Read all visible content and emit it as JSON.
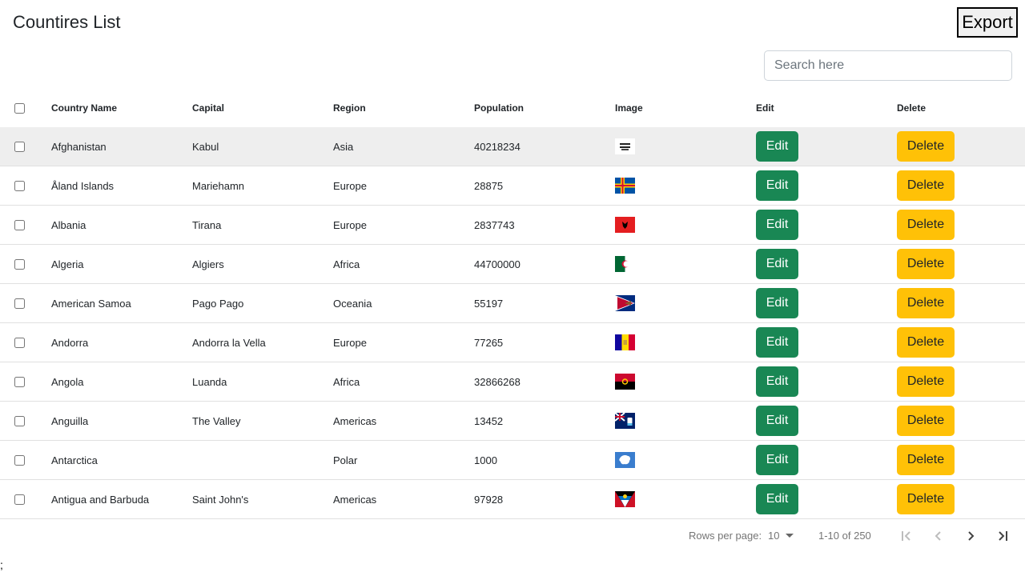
{
  "page": {
    "title": "Countires List",
    "export_label": "Export",
    "trailing_text": ";"
  },
  "search": {
    "placeholder": "Search here",
    "value": ""
  },
  "table": {
    "headers": {
      "name": "Country Name",
      "capital": "Capital",
      "region": "Region",
      "population": "Population",
      "image": "Image",
      "edit": "Edit",
      "delete": "Delete"
    },
    "rows": [
      {
        "name": "Afghanistan",
        "capital": "Kabul",
        "region": "Asia",
        "population": "40218234",
        "flag": "afghanistan-flag",
        "edit": "Edit",
        "delete": "Delete"
      },
      {
        "name": "Åland Islands",
        "capital": "Mariehamn",
        "region": "Europe",
        "population": "28875",
        "flag": "aland-flag",
        "edit": "Edit",
        "delete": "Delete"
      },
      {
        "name": "Albania",
        "capital": "Tirana",
        "region": "Europe",
        "population": "2837743",
        "flag": "albania-flag",
        "edit": "Edit",
        "delete": "Delete"
      },
      {
        "name": "Algeria",
        "capital": "Algiers",
        "region": "Africa",
        "population": "44700000",
        "flag": "algeria-flag",
        "edit": "Edit",
        "delete": "Delete"
      },
      {
        "name": "American Samoa",
        "capital": "Pago Pago",
        "region": "Oceania",
        "population": "55197",
        "flag": "american-samoa-flag",
        "edit": "Edit",
        "delete": "Delete"
      },
      {
        "name": "Andorra",
        "capital": "Andorra la Vella",
        "region": "Europe",
        "population": "77265",
        "flag": "andorra-flag",
        "edit": "Edit",
        "delete": "Delete"
      },
      {
        "name": "Angola",
        "capital": "Luanda",
        "region": "Africa",
        "population": "32866268",
        "flag": "angola-flag",
        "edit": "Edit",
        "delete": "Delete"
      },
      {
        "name": "Anguilla",
        "capital": "The Valley",
        "region": "Americas",
        "population": "13452",
        "flag": "anguilla-flag",
        "edit": "Edit",
        "delete": "Delete"
      },
      {
        "name": "Antarctica",
        "capital": "",
        "region": "Polar",
        "population": "1000",
        "flag": "antarctica-flag",
        "edit": "Edit",
        "delete": "Delete"
      },
      {
        "name": "Antigua and Barbuda",
        "capital": "Saint John's",
        "region": "Americas",
        "population": "97928",
        "flag": "antigua-flag",
        "edit": "Edit",
        "delete": "Delete"
      }
    ]
  },
  "pagination": {
    "rows_per_page_label": "Rows per page:",
    "rows_per_page": "10",
    "range": "1-10 of 250"
  },
  "colors": {
    "edit": "#198754",
    "delete": "#ffc107",
    "row_highlight": "#eeeeee"
  }
}
